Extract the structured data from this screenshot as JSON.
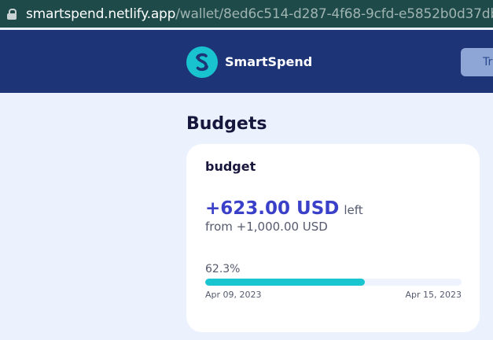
{
  "browser": {
    "url_host": "smartspend.netlify.app",
    "url_path": "/wallet/8ed6c514-d287-4f68-9cfd-e5852b0d37db/buc"
  },
  "header": {
    "brand_name": "SmartSpend",
    "logo_icon": "smartspend-s-logo-icon",
    "button_label": "Tr"
  },
  "page": {
    "title": "Budgets"
  },
  "budget": {
    "name": "budget",
    "amount_left": "+623.00 USD",
    "left_label": "left",
    "from_text": "from +1,000.00 USD",
    "percent": "62.3%",
    "progress_fraction": 0.623,
    "start_date": "Apr 09, 2023",
    "end_date": "Apr 15, 2023"
  },
  "colors": {
    "header_bg": "#1D3577",
    "accent_teal": "#19C5CF",
    "amount_blue": "#3B40C9",
    "page_bg": "#ECF2FD"
  }
}
